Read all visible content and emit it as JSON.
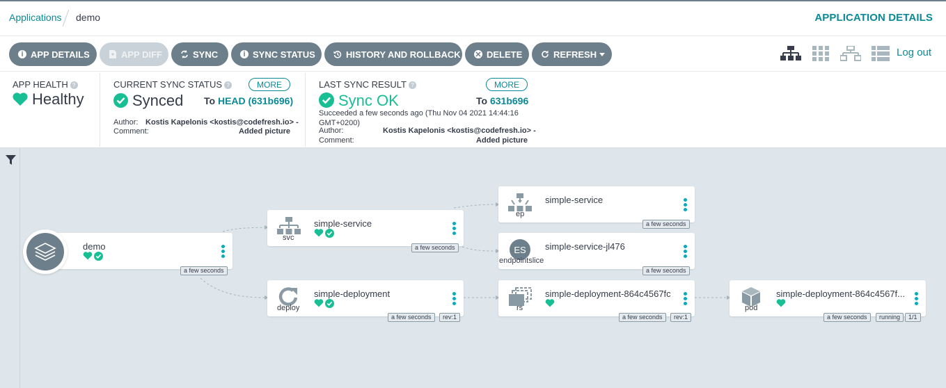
{
  "breadcrumb": {
    "applications": "Applications",
    "current": "demo"
  },
  "page_title": "APPLICATION DETAILS",
  "toolbar": {
    "app_details": "APP DETAILS",
    "app_diff": "APP DIFF",
    "sync": "SYNC",
    "sync_status": "SYNC STATUS",
    "history": "HISTORY AND ROLLBACK",
    "delete": "DELETE",
    "refresh": "REFRESH"
  },
  "logout": "Log out",
  "app_health": {
    "header": "APP HEALTH",
    "value": "Healthy"
  },
  "sync_status": {
    "header": "CURRENT SYNC STATUS",
    "value": "Synced",
    "more": "MORE",
    "to_label": "To",
    "to_value": "HEAD (631b696)",
    "author_label": "Author:",
    "author": "Kostis Kapelonis <kostis@codefresh.io> -",
    "comment_label": "Comment:",
    "comment": "Added picture"
  },
  "last_sync": {
    "header": "LAST SYNC RESULT",
    "value": "Sync OK",
    "more": "MORE",
    "to_label": "To",
    "to_value": "631b696",
    "succeeded_line1": "Succeeded a few seconds ago (Thu Nov 04 2021 14:44:16",
    "succeeded_line2": "GMT+0200)",
    "author_label": "Author:",
    "author": "Kostis Kapelonis <kostis@codefresh.io> -",
    "comment_label": "Comment:",
    "comment": "Added picture"
  },
  "tree": {
    "app": {
      "name": "demo",
      "age": "a few seconds"
    },
    "svc": {
      "name": "simple-service",
      "kind": "svc",
      "age": "a few seconds"
    },
    "ep": {
      "name": "simple-service",
      "kind": "ep",
      "age": "a few seconds"
    },
    "eps": {
      "name": "simple-service-jl476",
      "kind": "endpointslice",
      "age": "a few seconds",
      "icon_text": "ES"
    },
    "deploy": {
      "name": "simple-deployment",
      "kind": "deploy",
      "age": "a few seconds",
      "rev": "rev:1"
    },
    "rs": {
      "name": "simple-deployment-864c4567fc",
      "kind": "rs",
      "age": "a few seconds",
      "rev": "rev:1"
    },
    "pod": {
      "name": "simple-deployment-864c4567f...",
      "kind": "pod",
      "age": "a few seconds",
      "status": "running",
      "ready": "1/1"
    }
  },
  "colors": {
    "accent": "#0b8a95",
    "healthy": "#18be94",
    "button": "#6d7f8b"
  }
}
